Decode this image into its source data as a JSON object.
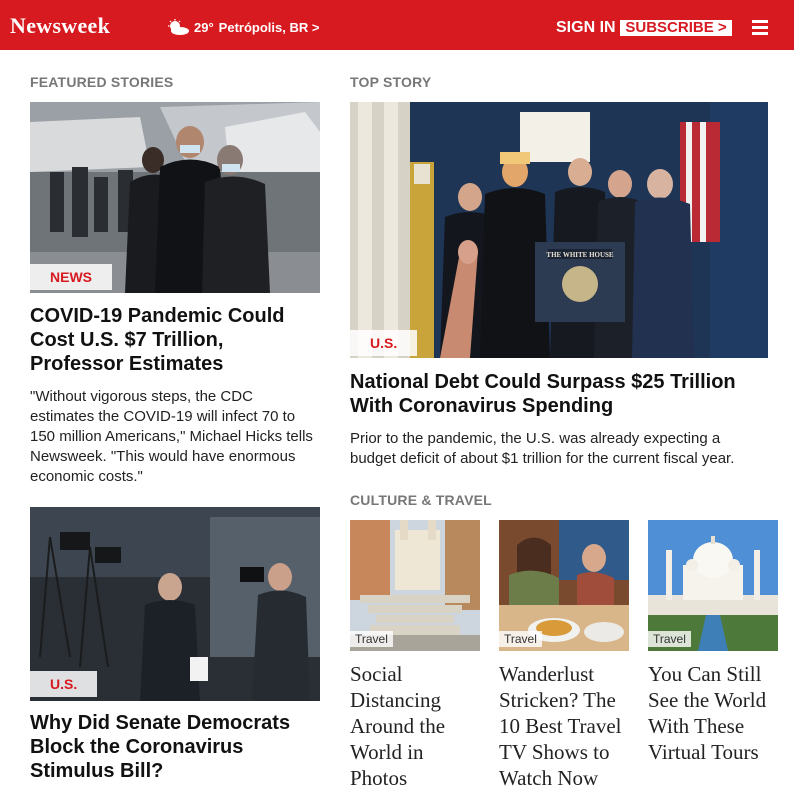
{
  "header": {
    "logo": "Newsweek",
    "weather_temp": "29°",
    "weather_city": "Petrópolis, BR >",
    "signin_label": "SIGN IN",
    "subscribe_label": "SUBSCRIBE >"
  },
  "featured": {
    "label": "FEATURED STORIES",
    "stories": [
      {
        "tag": "NEWS",
        "title": "COVID-19 Pandemic Could Cost U.S. $7 Trillion, Professor Estimates",
        "summary": "\"Without vigorous steps, the CDC estimates the COVID-19 will infect 70 to 150 million Americans,\" Michael Hicks tells Newsweek. \"This would have enormous economic costs.\""
      },
      {
        "tag": "U.S.",
        "title": "Why Did Senate Democrats Block the Coronavirus Stimulus Bill?",
        "summary": ""
      }
    ]
  },
  "top": {
    "label": "TOP STORY",
    "tag": "U.S.",
    "title": "National Debt Could Surpass $25 Trillion With Coronavirus Spending",
    "summary": "Prior to the pandemic, the U.S. was already expecting a budget deficit of about $1 trillion for the current fiscal year.",
    "podium_sign": "THE WHITE HOUSE"
  },
  "culture": {
    "label": "CULTURE & TRAVEL",
    "cards": [
      {
        "tag": "Travel",
        "title": "Social Distancing Around the World in Photos"
      },
      {
        "tag": "Travel",
        "title": "Wanderlust Stricken? The 10 Best Travel TV Shows to Watch Now"
      },
      {
        "tag": "Travel",
        "title": "You Can Still See the World With These Virtual Tours"
      }
    ]
  },
  "colors": {
    "brand": "#d71920",
    "label": "#777777"
  }
}
